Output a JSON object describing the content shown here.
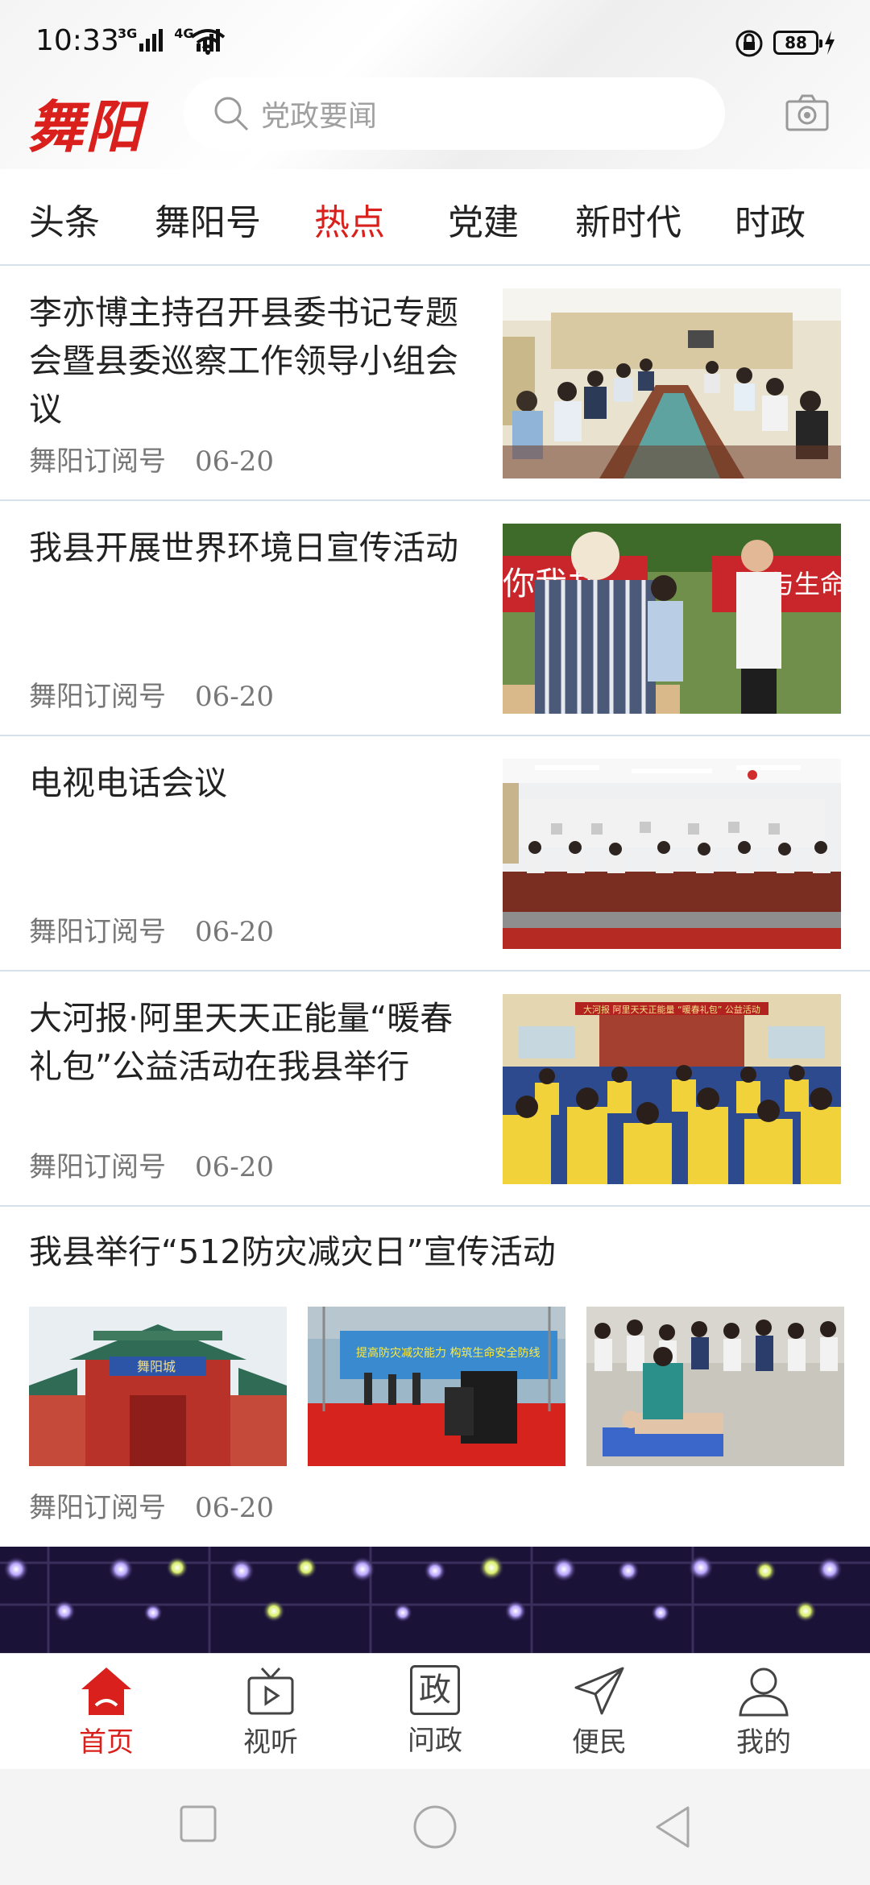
{
  "status_bar": {
    "time": "10:33",
    "net1": "3G",
    "net2": "4G",
    "battery": "88"
  },
  "header": {
    "logo": "舞阳",
    "search_placeholder": "党政要闻"
  },
  "tabs": [
    {
      "label": "头条",
      "active": false
    },
    {
      "label": "舞阳号",
      "active": false
    },
    {
      "label": "热点",
      "active": true
    },
    {
      "label": "党建",
      "active": false
    },
    {
      "label": "新时代",
      "active": false
    },
    {
      "label": "时政",
      "active": false
    }
  ],
  "articles": [
    {
      "title": "李亦博主持召开县委书记专题会暨县委巡察工作领导小组会议",
      "source": "舞阳订阅号",
      "date": "06-20"
    },
    {
      "title": "我县开展世界环境日宣传活动",
      "source": "舞阳订阅号",
      "date": "06-20"
    },
    {
      "title": "电视电话会议",
      "source": "舞阳订阅号",
      "date": "06-20"
    },
    {
      "title": "大河报·阿里天天正能量“暖春礼包”公益活动在我县举行",
      "source": "舞阳订阅号",
      "date": "06-20"
    }
  ],
  "photo_texts": {
    "banner_left": "你我共",
    "banner_right": "与生命",
    "school_banner": "大河报 阿里天天正能量 “暖春礼包” 公益活动",
    "gate_sign": "舞阳城",
    "stage_banner": "提高防灾减灾能力 构筑生命安全防线"
  },
  "multi_article": {
    "title": "我县举行“512防灾减灾日”宣传活动",
    "source": "舞阳订阅号",
    "date": "06-20"
  },
  "bottom_nav": [
    {
      "label": "首页",
      "icon": "home-icon",
      "active": true
    },
    {
      "label": "视听",
      "icon": "tv-icon",
      "active": false
    },
    {
      "label": "问政",
      "icon": "zheng-icon",
      "glyph": "政",
      "active": false
    },
    {
      "label": "便民",
      "icon": "send-icon",
      "active": false
    },
    {
      "label": "我的",
      "icon": "user-icon",
      "active": false
    }
  ],
  "colors": {
    "accent": "#d9201c",
    "divider": "#d6e0ea"
  }
}
